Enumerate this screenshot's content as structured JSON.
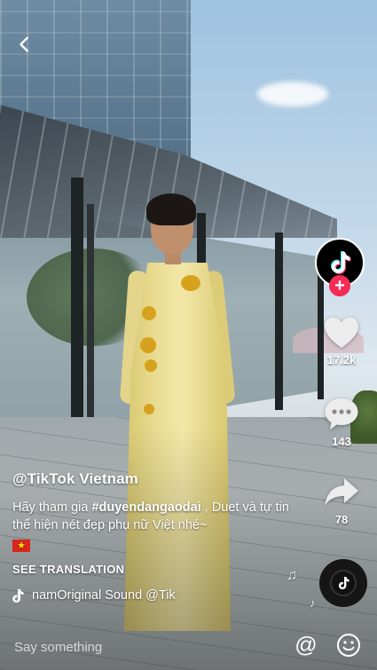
{
  "nav": {
    "back_icon": "chevron-left-icon"
  },
  "creator": {
    "avatar_icon": "tiktok-logo-icon",
    "follow_symbol": "+"
  },
  "actions": {
    "like": {
      "icon": "heart-icon",
      "count": "17.2k"
    },
    "comment": {
      "icon": "comment-bubble-icon",
      "count": "143"
    },
    "share": {
      "icon": "share-arrow-icon",
      "count": "78"
    }
  },
  "caption": {
    "username": "@TikTok Vietnam",
    "text_before": "Hãy tham gia ",
    "hashtag": "#duyendangaodai",
    "text_after": " , Duet và tự tin thể hiện nét đẹp phụ nữ Việt nhé~",
    "flag_icon": "vietnam-flag-icon",
    "see_translation": "SEE TRANSLATION"
  },
  "sound": {
    "icon": "music-note-icon",
    "label": "namOriginal Sound    @Tik"
  },
  "music_disc": {
    "icon": "spinning-record-icon"
  },
  "comment_bar": {
    "placeholder": "Say something",
    "mention_symbol": "@",
    "emoji_icon": "smiley-icon"
  },
  "colors": {
    "accent": "#f52c56",
    "text": "#ffffff",
    "dress": "#efe29e"
  }
}
